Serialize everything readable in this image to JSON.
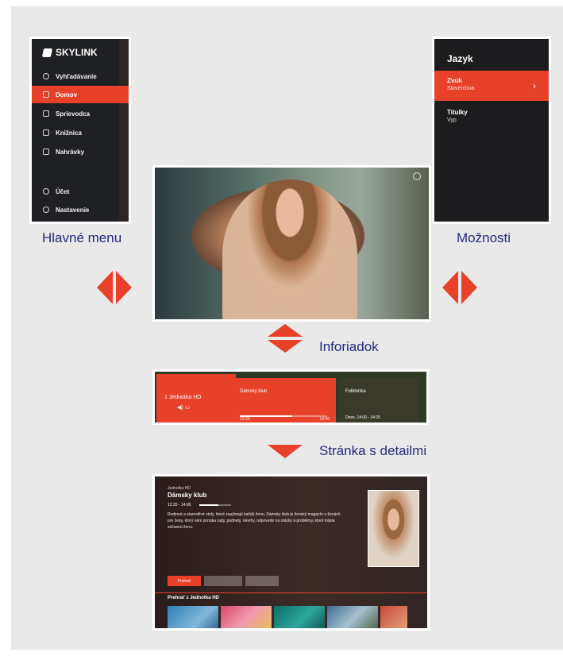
{
  "colors": {
    "accent": "#e8412a",
    "caption": "#23297a",
    "panel": "#e9e9ea"
  },
  "main_menu": {
    "caption": "Hlavné menu",
    "brand": "SKYLINK",
    "items": [
      {
        "label": "Vyhľadávanie",
        "icon": "search-icon",
        "active": false
      },
      {
        "label": "Domov",
        "icon": "home-icon",
        "active": true
      },
      {
        "label": "Sprievodca",
        "icon": "guide-icon",
        "active": false
      },
      {
        "label": "Knižnica",
        "icon": "library-icon",
        "active": false
      },
      {
        "label": "Nahrávky",
        "icon": "recording-icon",
        "active": false
      },
      {
        "label": "Účet",
        "icon": "account-icon",
        "active": false
      },
      {
        "label": "Nastavenie",
        "icon": "gear-icon",
        "active": false
      }
    ]
  },
  "options": {
    "caption": "Možnosti",
    "title": "Jazyk",
    "rows": [
      {
        "label": "Zvuk",
        "value": "Slovenčina",
        "active": true
      },
      {
        "label": "Titulky",
        "value": "Vyp",
        "active": false
      }
    ]
  },
  "info_bar": {
    "caption": "Inforiadok",
    "channel_name": "1  Jednotka HD",
    "program_title": "Dámsky klub",
    "progress_start": "12:20",
    "progress_end": "14:00",
    "progress_fraction": 0.6,
    "next_title": "Folklorika",
    "next_time": "Dnes, 14:00 - 14:25"
  },
  "detail": {
    "caption": "Stránka s detailmi",
    "channel": "Jednotka HD",
    "title": "Dámsky klub",
    "time": "12:20 - 14:00",
    "progress_fraction": 0.6,
    "description": "Rodinné a starostlivé stoly, ktoré zaujímajú každú ženu. Dámsky klub je ženský magazín o ženách pre ženy, ktorý vám ponúka rady, podnety, návrhy, odpovede na otázky a problémy, ktoré trápia súčasnú ženu.",
    "buttons": [
      "Prehrať",
      "",
      ""
    ],
    "row_label": "Prehrať z Jednotka HD"
  }
}
